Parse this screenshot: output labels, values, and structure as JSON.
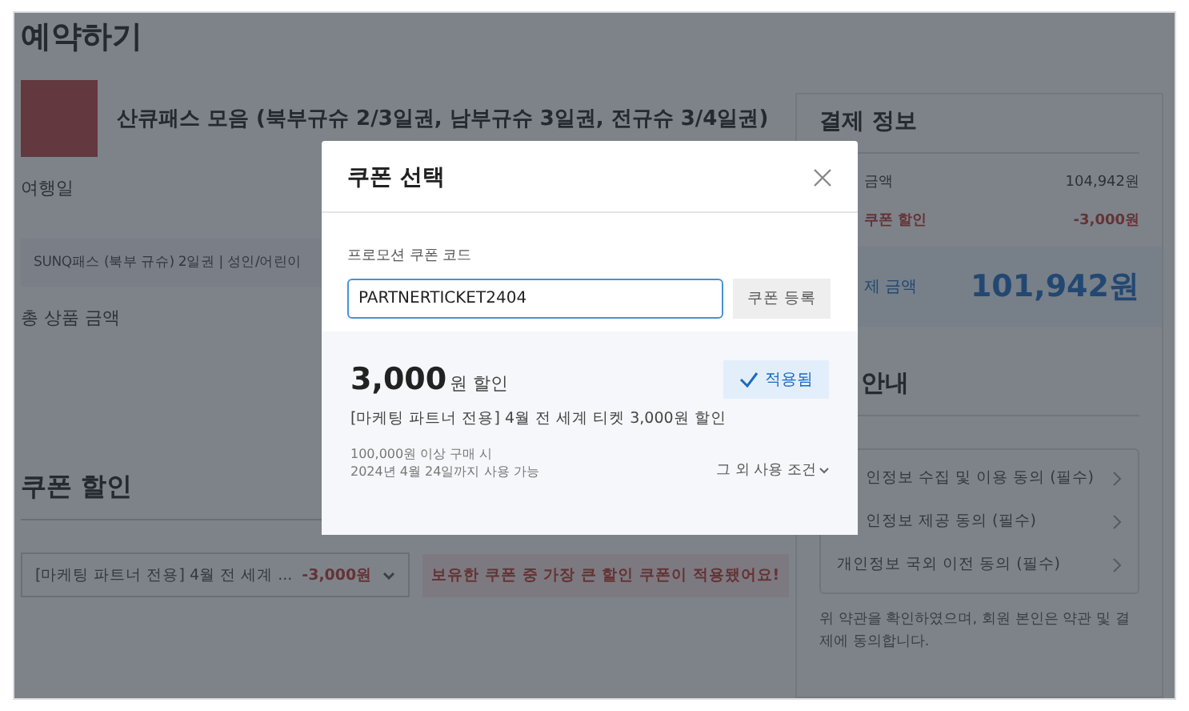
{
  "page": {
    "title": "예약하기",
    "product": {
      "name": "산큐패스 모음 (북부규슈 2/3일권, 남부규슈 3일권, 전규슈 3/4일권)"
    },
    "travel_date_label": "여행일",
    "option_row": "SUNQ패스 (북부 규슈) 2일권 | 성인/어린이",
    "total_label": "총 상품 금액",
    "coupon_section": {
      "title": "쿠폰 할인",
      "selected_coupon": "[마케팅 파트너 전용] 4월 전 세계 ...",
      "selected_amount": "-3,000원",
      "message": "보유한 쿠폰 중 가장 큰 할인 쿠폰이 적용됐어요!"
    }
  },
  "payment": {
    "title": "결제 정보",
    "rows": [
      {
        "label": "금액",
        "value": "104,942원",
        "kind": "normal"
      },
      {
        "label": "쿠폰 할인",
        "value": "-3,000원",
        "kind": "discount"
      }
    ],
    "total_label": "제 금액",
    "total_value": "101,942원"
  },
  "terms": {
    "title": "안내",
    "items": [
      {
        "label": "인정보 수집 및 이용 동의 (필수)",
        "covered": true
      },
      {
        "label": "인정보 제공 동의 (필수)",
        "covered": true
      },
      {
        "label": "개인정보 국외 이전 동의 (필수)",
        "covered": false
      }
    ],
    "note": "위 약관을 확인하였으며, 회원 본인은 약관 및 결제에 동의합니다."
  },
  "modal": {
    "title": "쿠폰 선택",
    "code_label": "프로모션 쿠폰 코드",
    "code_value": "PARTNERTICKET2404",
    "register_button": "쿠폰 등록",
    "coupons": [
      {
        "amount": "3,000",
        "unit": "원 할인",
        "applied": true,
        "applied_label": "적용됨",
        "name": "[마케팅 파트너 전용] 4월 전 세계 티켓 3,000원 할인",
        "conditions": [
          "100,000원 이상 구매 시",
          "2024년 4월 24일까지 사용 가능"
        ],
        "more_link": "그 외 사용 조건"
      }
    ]
  }
}
